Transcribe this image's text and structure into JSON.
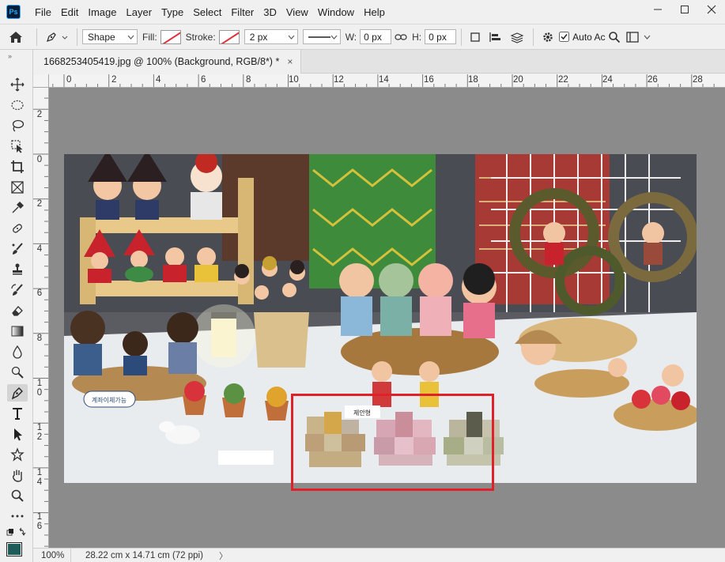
{
  "app": {
    "logo_text": "Ps"
  },
  "menu": [
    "File",
    "Edit",
    "Image",
    "Layer",
    "Type",
    "Select",
    "Filter",
    "3D",
    "View",
    "Window",
    "Help"
  ],
  "options": {
    "mode": "Shape",
    "fill_label": "Fill:",
    "stroke_label": "Stroke:",
    "stroke_width": "2 px",
    "w_label": "W:",
    "w_value": "0 px",
    "h_label": "H:",
    "h_value": "0 px",
    "auto_add": "Auto Ac"
  },
  "document": {
    "tab_title": "1668253405419.jpg @ 100% (Background, RGB/8*) *",
    "close_symbol": "×",
    "image_text": "계좌이체가능",
    "image_text2": "제안형"
  },
  "rulers": {
    "top_labels": [
      "0",
      "2",
      "4",
      "6",
      "8",
      "10",
      "12",
      "14",
      "16",
      "18",
      "20",
      "22",
      "24",
      "26",
      "28"
    ],
    "left_labels": [
      "2",
      "0",
      "2",
      "4",
      "6",
      "8",
      "10",
      "12",
      "14",
      "16"
    ]
  },
  "status": {
    "zoom": "100%",
    "doc_size": "28.22 cm x 14.71 cm (72 ppi)",
    "arrow": "〉"
  },
  "colors": {
    "foreground": "#1d5c58",
    "selection": "#e0212a",
    "canvas_bg": "#8b8b8b"
  }
}
